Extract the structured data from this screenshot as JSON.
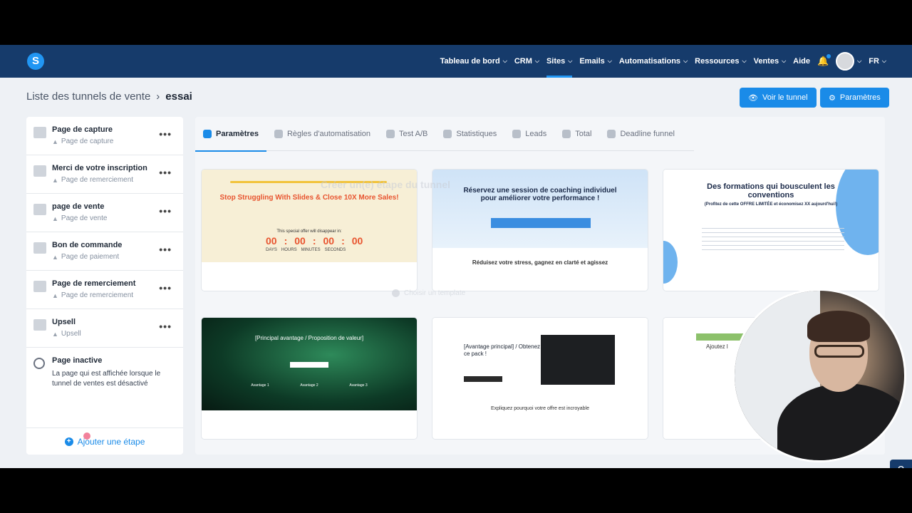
{
  "nav": {
    "logo": "S",
    "items": [
      {
        "label": "Tableau de bord",
        "chevron": true
      },
      {
        "label": "CRM",
        "chevron": true
      },
      {
        "label": "Sites",
        "chevron": true,
        "active": true
      },
      {
        "label": "Emails",
        "chevron": true
      },
      {
        "label": "Automatisations",
        "chevron": true
      },
      {
        "label": "Ressources",
        "chevron": true
      },
      {
        "label": "Ventes",
        "chevron": true
      },
      {
        "label": "Aide",
        "chevron": false
      }
    ],
    "language": "FR"
  },
  "header": {
    "breadcrumb_parent": "Liste des tunnels de vente",
    "breadcrumb_sep": "›",
    "breadcrumb_current": "essai",
    "view_button": "Voir le tunnel",
    "settings_button": "Paramètres"
  },
  "steps": [
    {
      "name": "Page de capture",
      "type": "Page de capture"
    },
    {
      "name": "Merci de votre inscription",
      "type": "Page de remerciement"
    },
    {
      "name": "page de vente",
      "type": "Page de vente"
    },
    {
      "name": "Bon de commande",
      "type": "Page de paiement"
    },
    {
      "name": "Page de remerciement",
      "type": "Page de remerciement"
    },
    {
      "name": "Upsell",
      "type": "Upsell"
    }
  ],
  "inactive": {
    "title": "Page inactive",
    "description": "La page qui est affichée lorsque le tunnel de ventes est désactivé"
  },
  "add_step": "Ajouter une étape",
  "tabs": [
    {
      "label": "Paramètres",
      "active": true
    },
    {
      "label": "Règles d'automatisation"
    },
    {
      "label": "Test A/B"
    },
    {
      "label": "Statistiques"
    },
    {
      "label": "Leads"
    },
    {
      "label": "Total"
    },
    {
      "label": "Deadline funnel"
    }
  ],
  "cards": {
    "c1": {
      "headline": "Stop Struggling With Slides & Close 10X More Sales!",
      "offer": "This special offer will disappear in:",
      "timer": [
        "00",
        "00",
        "00",
        "00"
      ],
      "timer_labels": [
        "DAYS",
        "HOURS",
        "MINUTES",
        "SECONDS"
      ]
    },
    "c2": {
      "headline": "Réservez une session de coaching individuel pour améliorer votre performance !",
      "footer": "Réduisez votre stress, gagnez en clarté et agissez"
    },
    "c3": {
      "headline": "Des formations qui bousculent les conventions",
      "sub": "(Profitez de cette OFFRE LIMITÉE et économisez XX aujourd'hui!)"
    },
    "c4": {
      "headline": "[Principal avantage / Proposition de valeur]",
      "features": [
        "Avantage 1",
        "Avantage 2",
        "Avantage 3"
      ]
    },
    "c5": {
      "headline": "[Avantage principal] / Obtenez ce pack !",
      "footer": "Expliquez pourquoi votre offre est incroyable"
    },
    "c6": {
      "headline": "Ajoutez l"
    }
  },
  "modal_ghost": {
    "title": "Créer un(e) étape du tunnel",
    "option": "Choisir un template"
  },
  "help": "?"
}
